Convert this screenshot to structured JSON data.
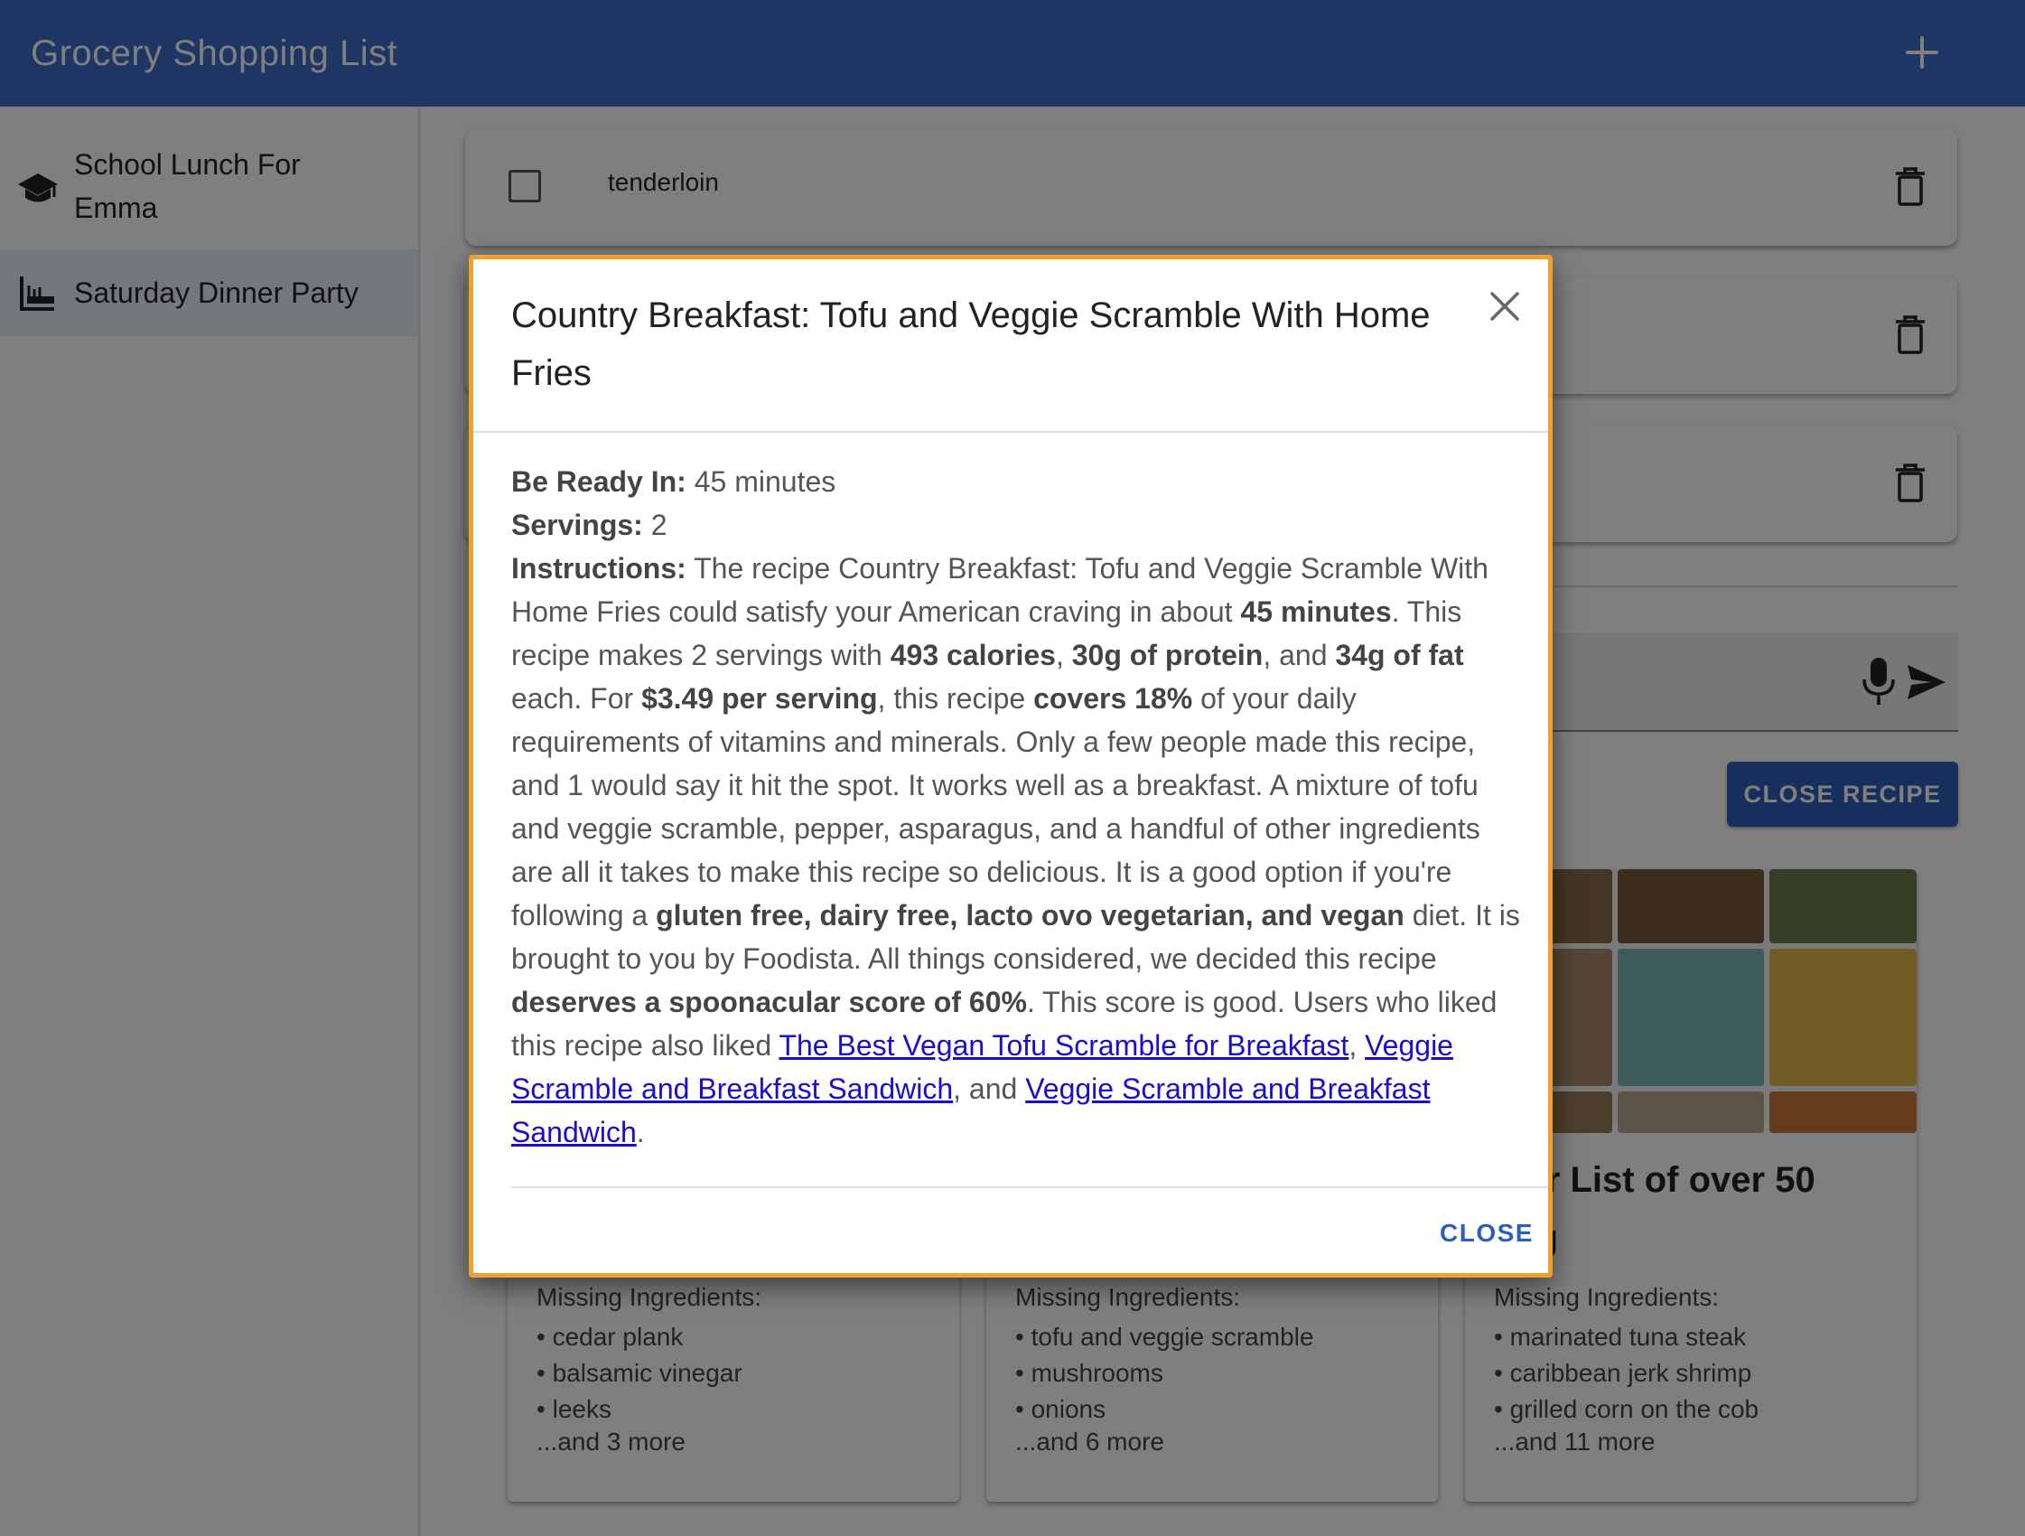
{
  "app": {
    "title": "Grocery Shopping List",
    "add_icon": "plus-icon"
  },
  "sidebar": {
    "items": [
      {
        "label_line1": "School Lunch For",
        "label_line2": "Emma",
        "icon": "school-icon"
      },
      {
        "label": "Saturday Dinner Party",
        "icon": "dinner-icon"
      }
    ]
  },
  "list": {
    "items": [
      {
        "name": "tenderloin",
        "checked": false
      }
    ]
  },
  "actions": {
    "close_recipe": "CLOSE RECIPE"
  },
  "recipes": [
    {
      "missing_heading": "Missing Ingredients:",
      "ingredients": [
        "cedar plank",
        "balsamic vinegar",
        "leeks"
      ],
      "more": "...and 3 more"
    },
    {
      "missing_heading": "Missing Ingredients:",
      "ingredients": [
        "tofu and veggie scramble",
        "mushrooms",
        "onions"
      ],
      "more": "...and 6 more"
    },
    {
      "title_line1": "ster List of over 50",
      "title_line2": "ling",
      "missing_heading": "Missing Ingredients:",
      "ingredients": [
        "marinated tuna steak",
        "caribbean jerk shrimp",
        "grilled corn on the cob"
      ],
      "more": "...and 11 more"
    }
  ],
  "dialog": {
    "title": "Country Breakfast: Tofu and Veggie Scramble With Home Fries",
    "ready_label": "Be Ready In:",
    "ready_value": "45 minutes",
    "servings_label": "Servings:",
    "servings_value": "2",
    "instructions_label": "Instructions:",
    "instr": {
      "p1": "The recipe Country Breakfast: Tofu and Veggie Scramble With Home Fries could satisfy your American craving in about ",
      "b1": "45 minutes",
      "p2": ". This recipe makes 2 servings with ",
      "b2": "493 calories",
      "p3": ", ",
      "b3": "30g of protein",
      "p4": ", and ",
      "b4": "34g of fat",
      "p5": " each. For ",
      "b5": "$3.49 per serving",
      "p6": ", this recipe ",
      "b6": "covers 18%",
      "p7": " of your daily requirements of vitamins and minerals. Only a few people made this recipe, and 1 would say it hit the spot. It works well as a breakfast. A mixture of tofu and veggie scramble, pepper, asparagus, and a handful of other ingredients are all it takes to make this recipe so delicious. It is a good option if you're following a ",
      "b7": "gluten free, dairy free, lacto ovo vegetarian, and vegan",
      "p8": " diet. It is brought to you by Foodista. All things considered, we decided this recipe ",
      "b8": "deserves a spoonacular score of 60%",
      "p9": ". This score is good. Users who liked this recipe also liked ",
      "link1": "The Best Vegan Tofu Scramble for Breakfast",
      "p10": ", ",
      "link2": "Veggie Scramble and Breakfast Sandwich",
      "p11": ", and ",
      "link3": "Veggie Scramble and Breakfast Sandwich",
      "p12": "."
    },
    "close_label": "CLOSE"
  },
  "colors": {
    "appbar": "#3b6cc6",
    "primary": "#2d5fb8",
    "dialog_border": "#f0a030",
    "link": "#1a0dcc"
  }
}
